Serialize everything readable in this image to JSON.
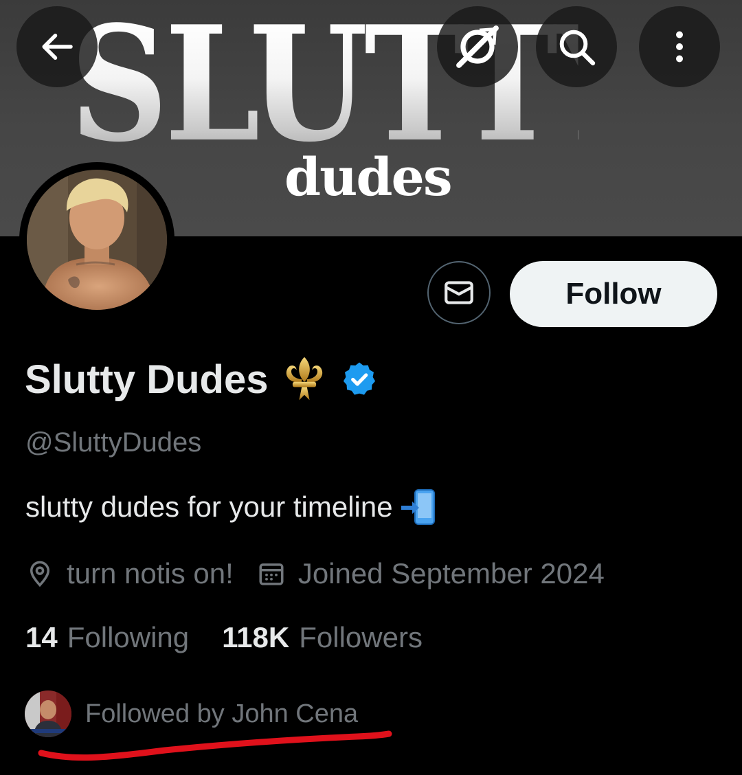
{
  "banner": {
    "big_text": "SLUTTY",
    "small_text": "dudes"
  },
  "top_bar": {
    "back_icon": "arrow-left-icon",
    "grok_icon": "grok-icon",
    "search_icon": "search-icon",
    "more_icon": "more-vertical-icon"
  },
  "actions": {
    "message_icon": "envelope-icon",
    "follow_label": "Follow"
  },
  "profile": {
    "display_name": "Slutty Dudes",
    "emoji": "⚜️",
    "verified_icon": "verified-badge-icon",
    "handle": "@SluttyDudes",
    "bio": "slutty dudes for your timeline",
    "bio_emoji": "📲",
    "location": "turn notis on!",
    "location_icon": "location-pin-icon",
    "joined": "Joined September 2024",
    "joined_icon": "calendar-icon",
    "following_count": "14",
    "following_label": "Following",
    "followers_count": "118K",
    "followers_label": "Followers",
    "followed_by": "Followed by John Cena"
  },
  "colors": {
    "background": "#000000",
    "text_primary": "#e7e9ea",
    "text_secondary": "#71767b",
    "verified_blue": "#1d9bf0",
    "follow_button_bg": "#eff3f4",
    "annotation_red": "#e0111b"
  }
}
